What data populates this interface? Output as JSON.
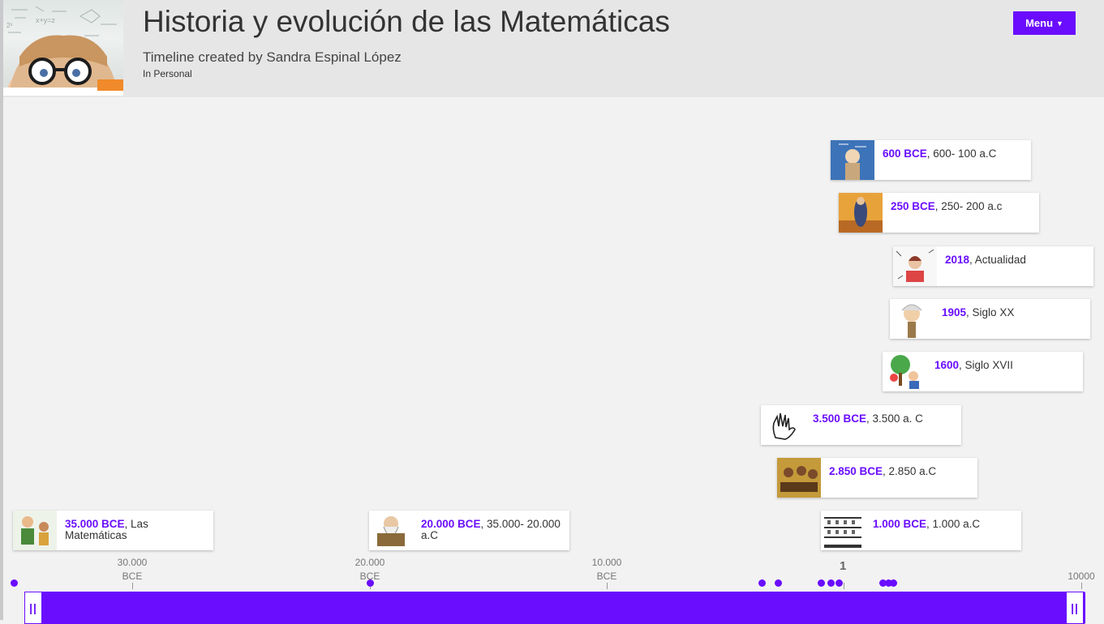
{
  "header": {
    "title": "Historia y evolución de las Matemáticas",
    "subtitle": "Timeline created by Sandra Espinal López",
    "category": "In Personal",
    "menu_label": "Menu"
  },
  "events": [
    {
      "date": "600 BCE",
      "desc": ", 600- 100 a.C"
    },
    {
      "date": "250 BCE",
      "desc": ", 250- 200 a.c"
    },
    {
      "date": "2018",
      "desc": ", Actualidad"
    },
    {
      "date": "1905",
      "desc": ", Siglo XX"
    },
    {
      "date": "1600",
      "desc": ", Siglo XVII"
    },
    {
      "date": "3.500 BCE",
      "desc": ", 3.500 a. C"
    },
    {
      "date": "2.850 BCE",
      "desc": ", 2.850 a.C"
    },
    {
      "date": "35.000 BCE",
      "desc": ", Las Matemáticas"
    },
    {
      "date": "20.000 BCE",
      "desc": ", 35.000- 20.000 a.C"
    },
    {
      "date": "1.000 BCE",
      "desc": ", 1.000 a.C"
    }
  ],
  "axis": {
    "labels": [
      {
        "value": "30.000",
        "era": "BCE"
      },
      {
        "value": "20.000",
        "era": "BCE"
      },
      {
        "value": "10.000",
        "era": "BCE"
      },
      {
        "value": "1",
        "era": ""
      },
      {
        "value": "10000",
        "era": ""
      }
    ]
  },
  "colors": {
    "accent": "#6a0dff",
    "header_bg": "#e6e6e7",
    "page_bg": "#f2f2f3"
  }
}
